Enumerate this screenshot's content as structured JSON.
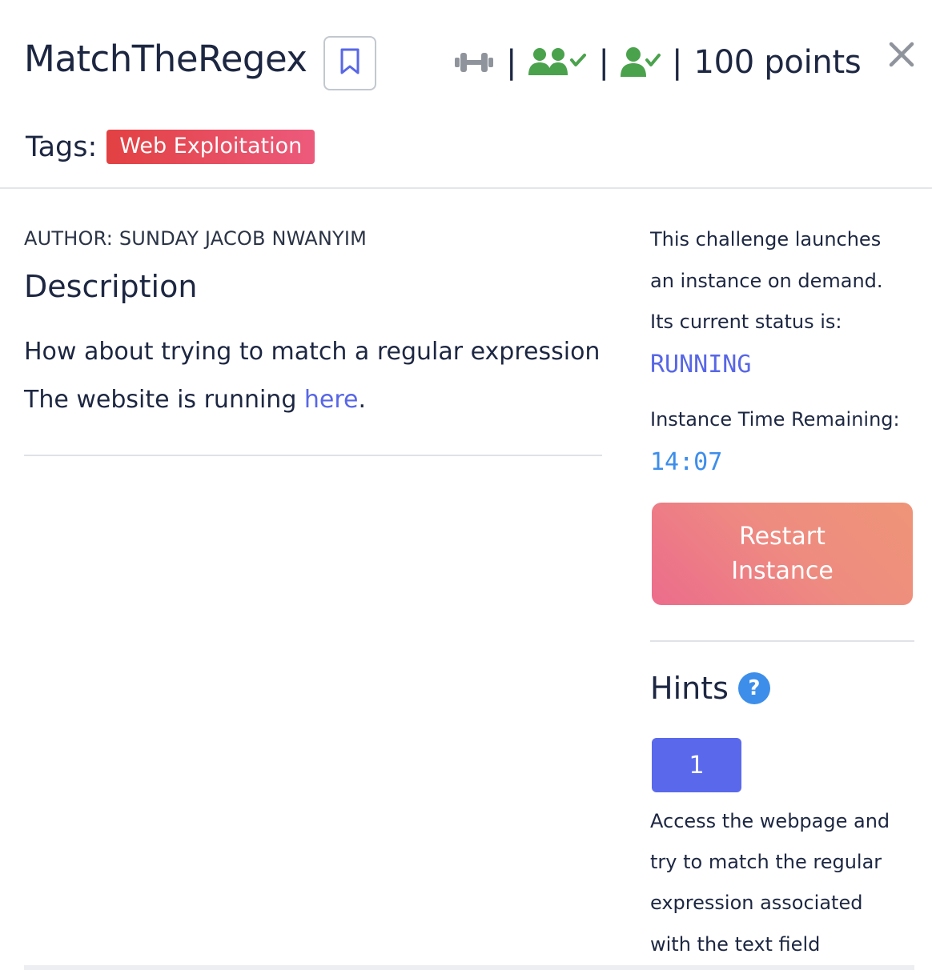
{
  "header": {
    "title": "MatchTheRegex",
    "separator": "|",
    "points": "100 points",
    "tags_label": "Tags:",
    "tags": [
      "Web Exploitation"
    ]
  },
  "icons": {
    "bookmark": "bookmark-icon",
    "difficulty": "dumbbell-icon",
    "solvers": "users-check-icon",
    "solved": "user-check-icon",
    "close": "close-icon",
    "help": "question-icon"
  },
  "colors": {
    "accent": "#5867e6",
    "success": "#4aa24d",
    "tag": "#e24142",
    "timer": "#3d8eea",
    "restart": "#ee8c80"
  },
  "main": {
    "author": "AUTHOR: SUNDAY JACOB NWANYIM",
    "description_heading": "Description",
    "description_line1": "How about trying to match a regular expression",
    "description_line2_prefix": "The website is running ",
    "description_link": "here",
    "description_line2_suffix": "."
  },
  "instance": {
    "info_lines": [
      "This challenge launches",
      "an instance on demand.",
      "Its current status is:"
    ],
    "status": "RUNNING",
    "time_label": "Instance Time Remaining:",
    "time_remaining": "14:07",
    "restart_line1": "Restart",
    "restart_line2": "Instance"
  },
  "hints": {
    "heading": "Hints",
    "help_glyph": "?",
    "hint_button": "1",
    "hint_lines": [
      "Access the webpage and",
      "try to match the regular",
      "expression associated",
      "with the text field"
    ]
  }
}
